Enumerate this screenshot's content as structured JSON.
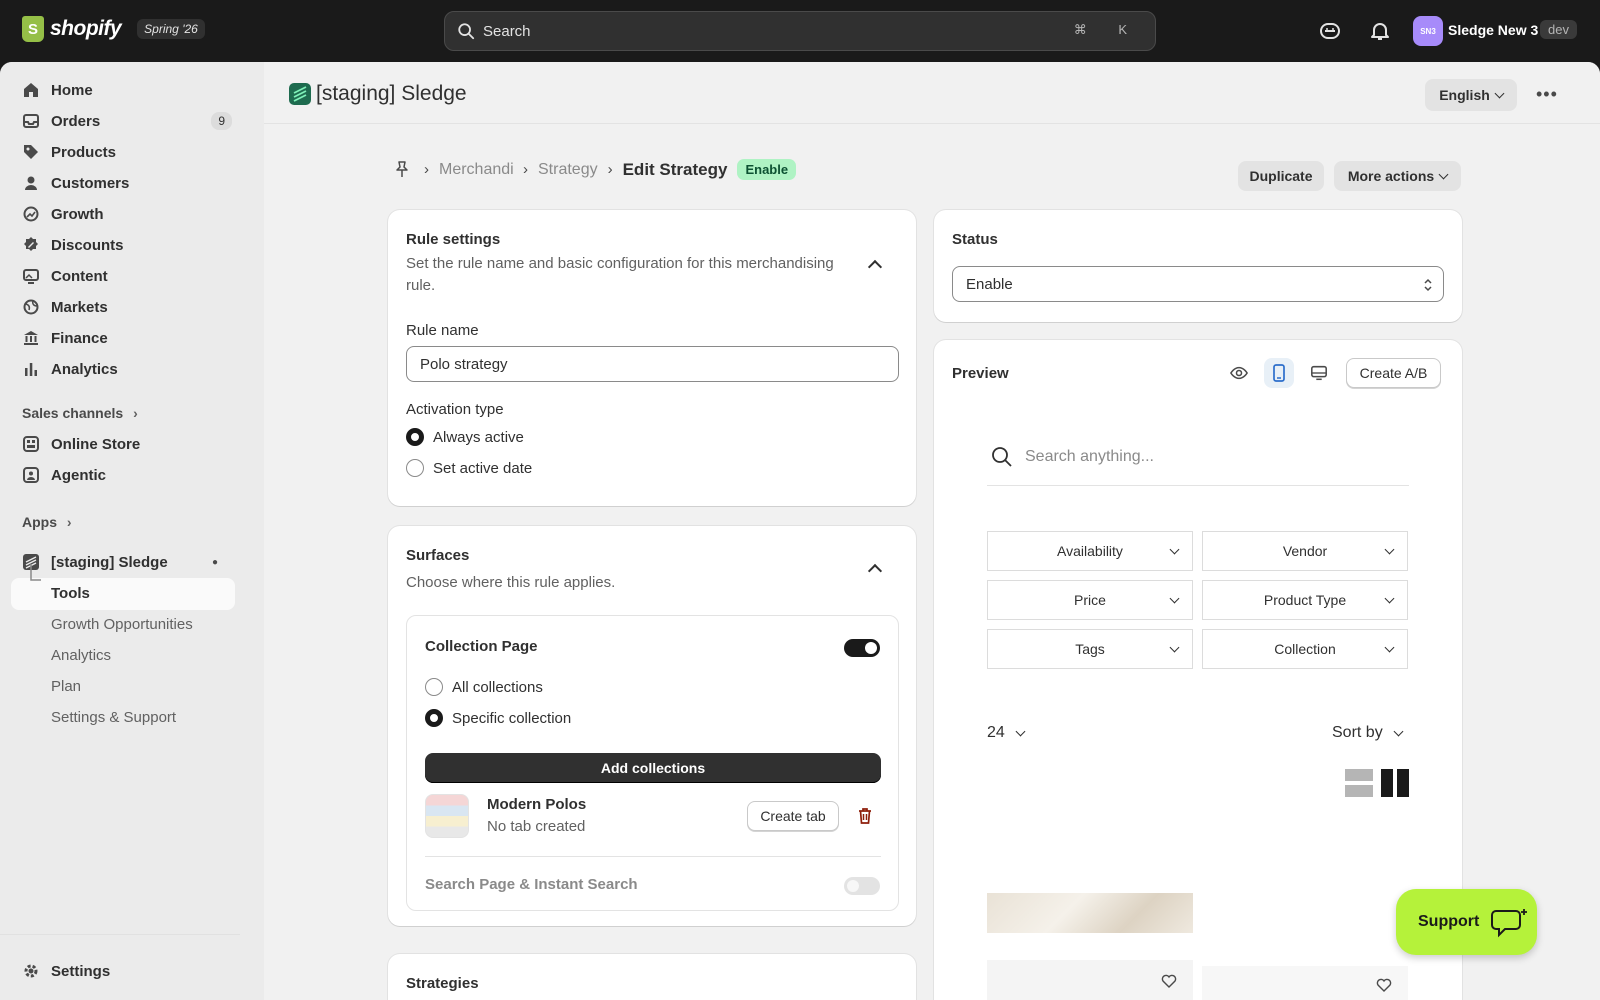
{
  "topbar": {
    "brand": "shopify",
    "edition": "Spring '26",
    "search_placeholder": "Search",
    "shortcut": "⌘ K",
    "avatar_initials": "SN3",
    "store_name": "Sledge New 3",
    "store_badge": "dev"
  },
  "sidebar": {
    "items": [
      {
        "label": "Home",
        "icon": "home-icon"
      },
      {
        "label": "Orders",
        "icon": "orders-icon",
        "badge": "9"
      },
      {
        "label": "Products",
        "icon": "tag-icon"
      },
      {
        "label": "Customers",
        "icon": "person-icon"
      },
      {
        "label": "Growth",
        "icon": "growth-icon"
      },
      {
        "label": "Discounts",
        "icon": "discount-icon"
      },
      {
        "label": "Content",
        "icon": "content-icon"
      },
      {
        "label": "Markets",
        "icon": "globe-icon"
      },
      {
        "label": "Finance",
        "icon": "bank-icon"
      },
      {
        "label": "Analytics",
        "icon": "bar-chart-icon"
      }
    ],
    "sales_channels_label": "Sales channels",
    "channels": [
      {
        "label": "Online Store",
        "icon": "store-icon"
      },
      {
        "label": "Agentic",
        "icon": "agentic-icon"
      }
    ],
    "apps_label": "Apps",
    "app_name": "[staging] Sledge",
    "app_sub": [
      "Tools",
      "Growth Opportunities",
      "Analytics",
      "Plan",
      "Settings & Support"
    ],
    "settings_label": "Settings"
  },
  "header": {
    "app_title": "[staging] Sledge",
    "language": "English"
  },
  "breadcrumb": {
    "items": [
      "Merchandising",
      "Strategy"
    ],
    "current": "Edit Strategy",
    "status_pill": "Enable"
  },
  "actions": {
    "duplicate": "Duplicate",
    "more": "More actions"
  },
  "rule_settings": {
    "title": "Rule settings",
    "desc": "Set the rule name and basic configuration for this merchandising rule.",
    "name_label": "Rule name",
    "name_value": "Polo strategy",
    "activation_label": "Activation type",
    "opt_always": "Always active",
    "opt_date": "Set active date"
  },
  "surfaces": {
    "title": "Surfaces",
    "desc": "Choose where this rule applies.",
    "collection_page": "Collection Page",
    "opt_all": "All collections",
    "opt_specific": "Specific collection",
    "add_collections": "Add collections",
    "collection_name": "Modern Polos",
    "collection_status": "No tab created",
    "create_tab": "Create tab",
    "search_page": "Search Page & Instant Search"
  },
  "strategies": {
    "title": "Strategies"
  },
  "status_card": {
    "title": "Status",
    "value": "Enable"
  },
  "preview": {
    "title": "Preview",
    "create_ab": "Create A/B",
    "search_placeholder": "Search anything...",
    "filters": [
      "Availability",
      "Vendor",
      "Price",
      "Product Type",
      "Tags",
      "Collection"
    ],
    "per_page": "24",
    "sort_by": "Sort by"
  },
  "support": {
    "label": "Support"
  }
}
